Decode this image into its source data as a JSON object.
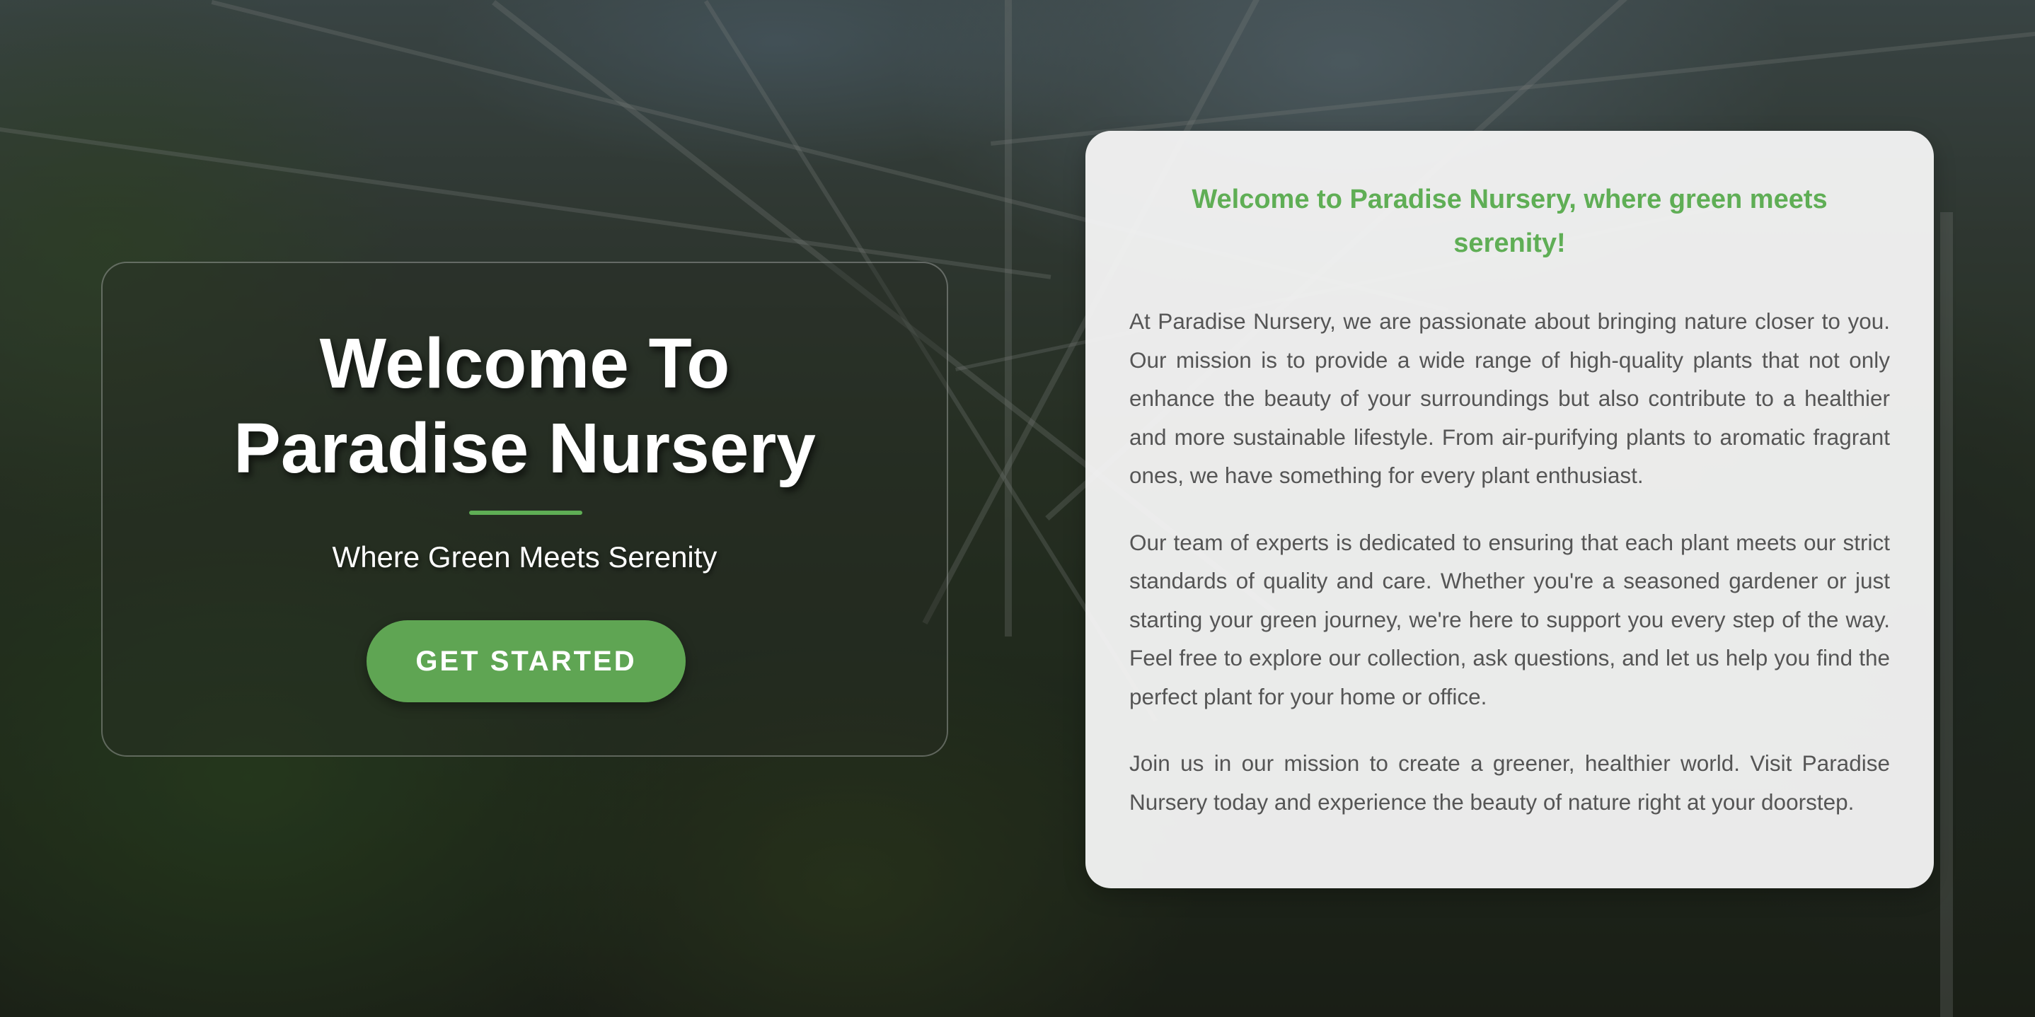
{
  "hero": {
    "title": "Welcome To Paradise Nursery",
    "subtitle": "Where Green Meets Serenity",
    "cta_label": "GET STARTED"
  },
  "about": {
    "heading": "Welcome to Paradise Nursery, where green meets serenity!",
    "paragraphs": [
      "At Paradise Nursery, we are passionate about bringing nature closer to you. Our mission is to provide a wide range of high-quality plants that not only enhance the beauty of your surroundings but also contribute to a healthier and more sustainable lifestyle. From air-purifying plants to aromatic fragrant ones, we have something for every plant enthusiast.",
      "Our team of experts is dedicated to ensuring that each plant meets our strict standards of quality and care. Whether you're a seasoned gardener or just starting your green journey, we're here to support you every step of the way. Feel free to explore our collection, ask questions, and let us help you find the perfect plant for your home or office.",
      "Join us in our mission to create a greener, healthier world. Visit Paradise Nursery today and experience the beauty of nature right at your doorstep."
    ]
  },
  "colors": {
    "accent_green": "#5fae55",
    "button_green": "#5fa553",
    "panel_text": "#555555",
    "panel_background": "#f6f6f6"
  }
}
